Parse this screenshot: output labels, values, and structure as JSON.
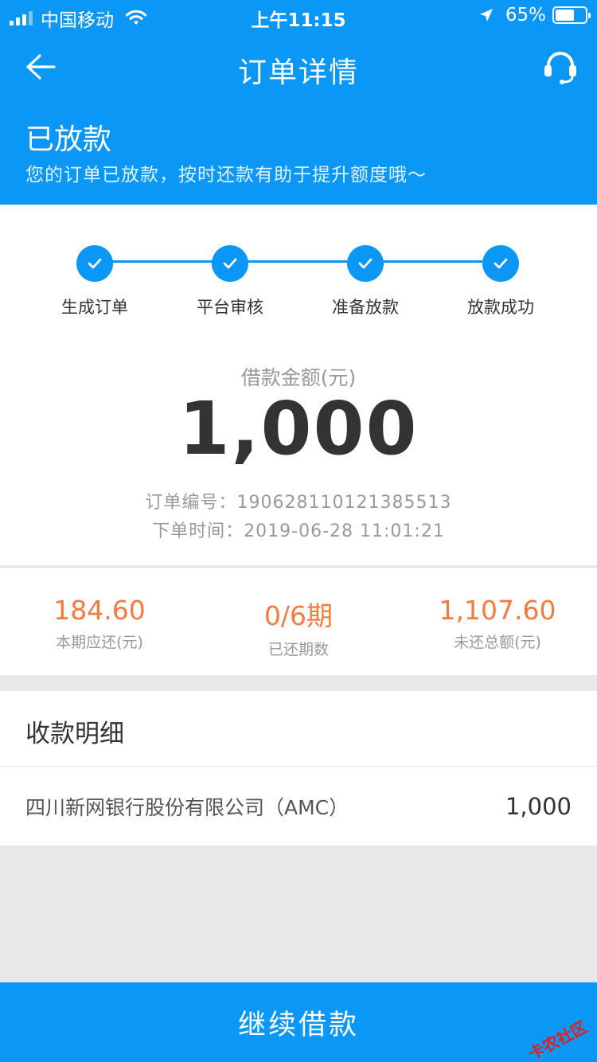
{
  "status_bar": {
    "carrier": "中国移动",
    "time": "上午11:15",
    "battery_percent": "65%",
    "battery_level": 0.65,
    "signal_bars_filled": 3,
    "signal_bars_total": 4,
    "icons": [
      "wifi-icon",
      "location-arrow-icon",
      "battery-icon"
    ]
  },
  "navbar": {
    "title": "订单详情",
    "icons": [
      "back-arrow-icon",
      "headset-support-icon"
    ]
  },
  "order_status": {
    "title": "已放款",
    "description": "您的订单已放款，按时还款有助于提升额度哦～"
  },
  "progress_steps": [
    {
      "label": "生成订单",
      "done": true
    },
    {
      "label": "平台审核",
      "done": true
    },
    {
      "label": "准备放款",
      "done": true
    },
    {
      "label": "放款成功",
      "done": true
    }
  ],
  "loan": {
    "amount_label": "借款金额(元)",
    "amount": "1,000",
    "order_no_label": "订单编号：",
    "order_no": "190628110121385513",
    "order_time_label": "下单时间：",
    "order_time": "2019-06-28 11:01:21"
  },
  "stats": [
    {
      "value": "184.60",
      "label": "本期应还(元)"
    },
    {
      "value": "0/6期",
      "label": "已还期数"
    },
    {
      "value": "1,107.60",
      "label": "未还总额(元)"
    }
  ],
  "receipt": {
    "title": "收款明细",
    "lender": "四川新网银行股份有限公司（AMC）",
    "amount": "1,000"
  },
  "cta": {
    "label": "继续借款"
  },
  "watermark": "卡农社区",
  "colors": {
    "primary": "#0b97f5",
    "accent_orange": "#f47b3e",
    "background": "#e8e8e8"
  }
}
